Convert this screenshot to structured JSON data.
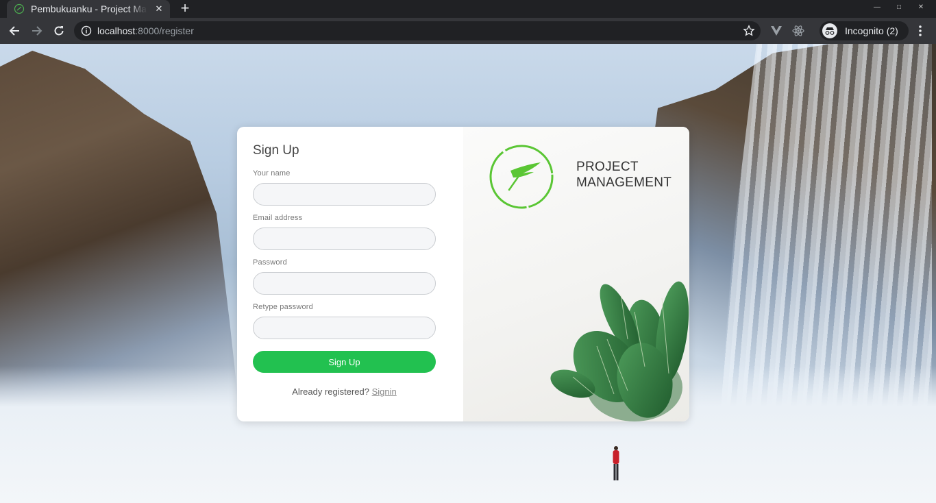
{
  "browser": {
    "tab_title": "Pembukuanku - Project Management",
    "url_host": "localhost",
    "url_rest": ":8000/register",
    "incognito_label": "Incognito (2)"
  },
  "form": {
    "title": "Sign Up",
    "fields": [
      {
        "label": "Your name",
        "value": "",
        "placeholder": ""
      },
      {
        "label": "Email address",
        "value": "",
        "placeholder": ""
      },
      {
        "label": "Password",
        "value": "",
        "placeholder": ""
      },
      {
        "label": "Retype password",
        "value": "",
        "placeholder": ""
      }
    ],
    "submit_label": "Sign Up",
    "already_text": "Already registered?",
    "signin_link": "Signin"
  },
  "brand": {
    "line1": "PROJECT",
    "line2": "MANAGEMENT"
  },
  "colors": {
    "accent": "#22c150",
    "chrome_dark": "#202124",
    "chrome_toolbar": "#35363a"
  },
  "icons": [
    "favicon-icon",
    "close-icon",
    "plus-icon",
    "minimize-icon",
    "maximize-icon",
    "window-close-icon",
    "back-arrow-icon",
    "forward-arrow-icon",
    "reload-icon",
    "info-icon",
    "star-icon",
    "vue-devtools-icon",
    "react-devtools-icon",
    "incognito-icon",
    "kebab-menu-icon",
    "logo-icon",
    "cactus-image"
  ]
}
